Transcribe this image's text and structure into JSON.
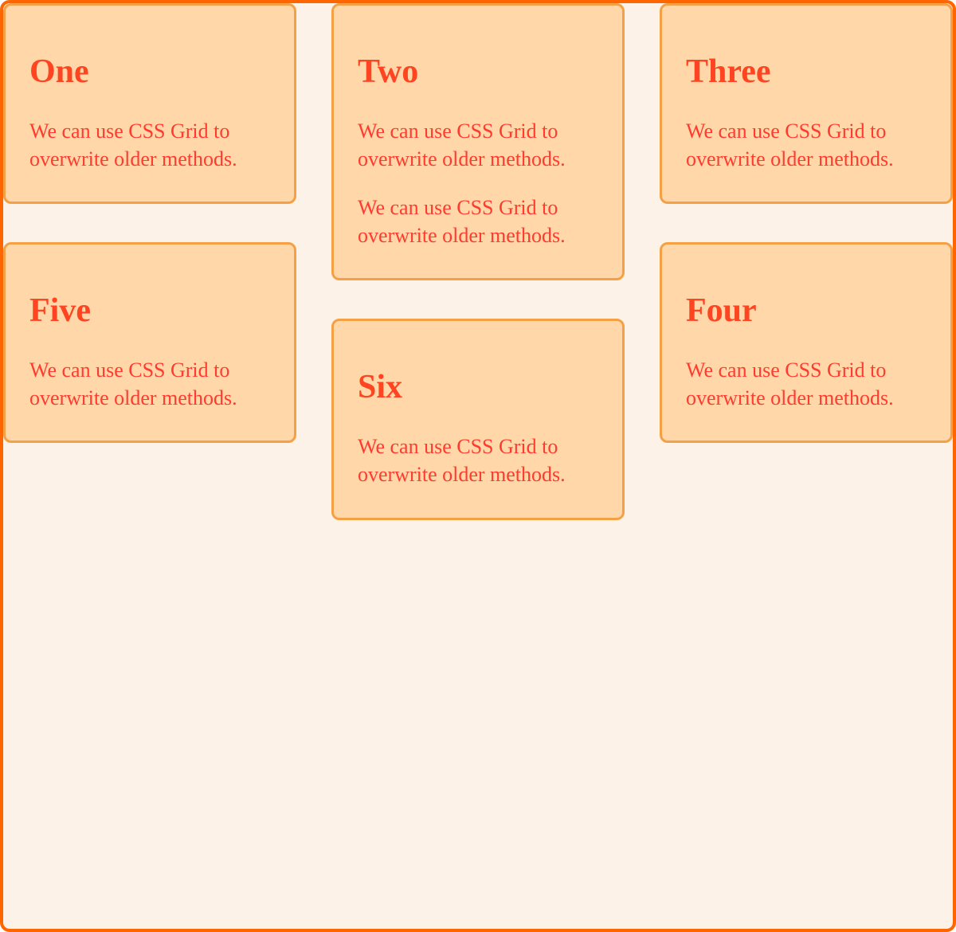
{
  "cards": [
    {
      "title": "One",
      "paragraphs": [
        "We can use CSS Grid to overwrite older methods."
      ]
    },
    {
      "title": "Two",
      "paragraphs": [
        "We can use CSS Grid to overwrite older methods.",
        "We can use CSS Grid to overwrite older methods."
      ]
    },
    {
      "title": "Three",
      "paragraphs": [
        "We can use CSS Grid to overwrite older methods."
      ]
    },
    {
      "title": "Four",
      "paragraphs": [
        "We can use CSS Grid to overwrite older methods."
      ]
    },
    {
      "title": "Five",
      "paragraphs": [
        "We can use CSS Grid to overwrite older methods."
      ]
    },
    {
      "title": "Six",
      "paragraphs": [
        "We can use CSS Grid to overwrite older methods."
      ]
    }
  ],
  "column_order": [
    0,
    4,
    1,
    5,
    2,
    3
  ]
}
